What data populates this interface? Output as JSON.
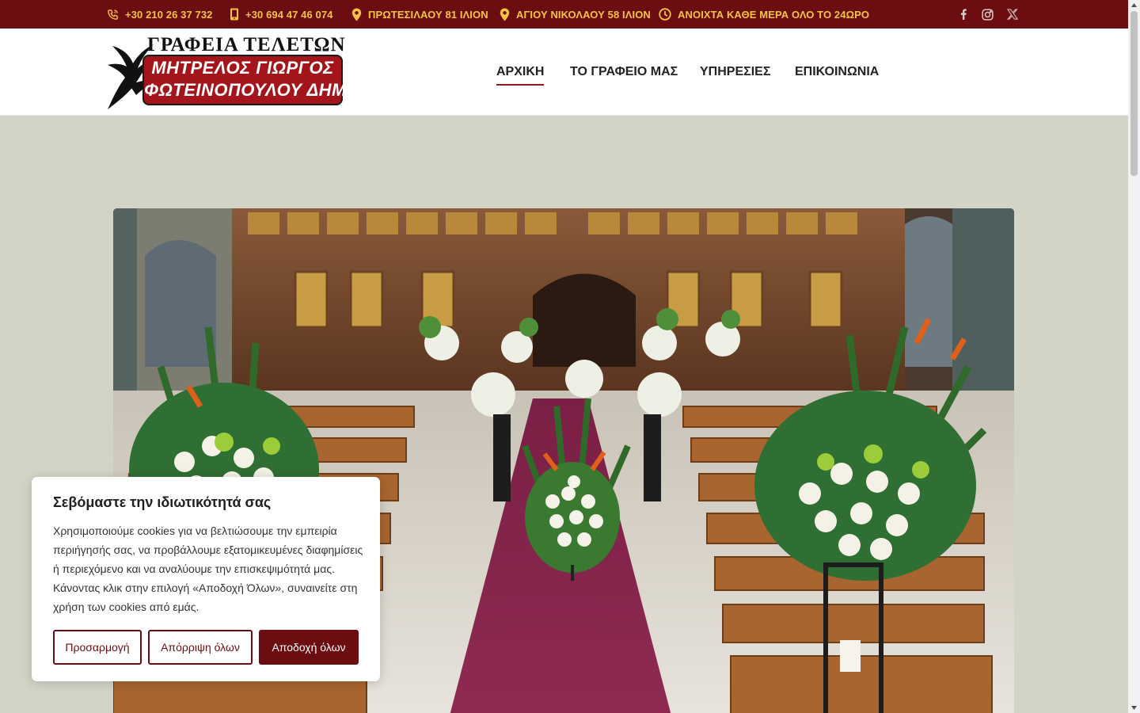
{
  "topbar": {
    "phone1": "+30 210 26 37 732",
    "phone2": "+30 694 47 46 074",
    "address1": "ΠΡΩΤΕΣΙΛΑΟΥ 81 ΙΛΙΟΝ",
    "address2": "ΑΓΙΟΥ ΝΙΚΟΛΑΟΥ 58 ΙΛΙΟΝ",
    "hours": "ΑΝΟΙΧΤΑ ΚΑΘΕ ΜΕΡΑ ΟΛΟ ΤΟ 24ΩΡΟ",
    "icons": [
      "phone-icon",
      "mobile-icon",
      "map-pin-icon",
      "map-pin-icon",
      "clock-icon"
    ],
    "social": [
      "facebook-icon",
      "instagram-icon",
      "x-twitter-icon"
    ]
  },
  "logo": {
    "title": "ΓΡΑΦΕΙΑ ΤΕΛΕΤΩΝ",
    "line1": "ΜΗΤΡΕΛΟΣ ΓΙΩΡΓΟΣ",
    "line2": "ΦΩΤΕΙΝΟΠΟΥΛΟΥ ΔΗΜΗΤΡΑ"
  },
  "nav": {
    "items": [
      "ΑΡΧΙΚΗ",
      "ΤΟ ΓΡΑΦΕΙΟ ΜΑΣ",
      "ΥΠΗΡΕΣΙΕΣ",
      "ΕΠΙΚΟΙΝΩΝΙΑ"
    ],
    "active": "ΑΡΧΙΚΗ"
  },
  "cookie": {
    "title": "Σεβόμαστε την ιδιωτικότητά σας",
    "text": "Χρησιμοποιούμε cookies για να βελτιώσουμε την εμπειρία περιήγησής σας, να προβάλλουμε εξατομικευμένες διαφημίσεις ή περιεχόμενο και να αναλύουμε την επισκεψιμότητά μας. Κάνοντας κλικ στην επιλογή «Αποδοχή Όλων», συναινείτε στη χρήση των cookies από εμάς.",
    "customize": "Προσαρμογή",
    "reject": "Απόρριψη όλων",
    "accept": "Αποδοχή όλων"
  },
  "colors": {
    "brand": "#6b0d11",
    "topbar_text": "#f4c542",
    "background": "#d2d5c6"
  }
}
